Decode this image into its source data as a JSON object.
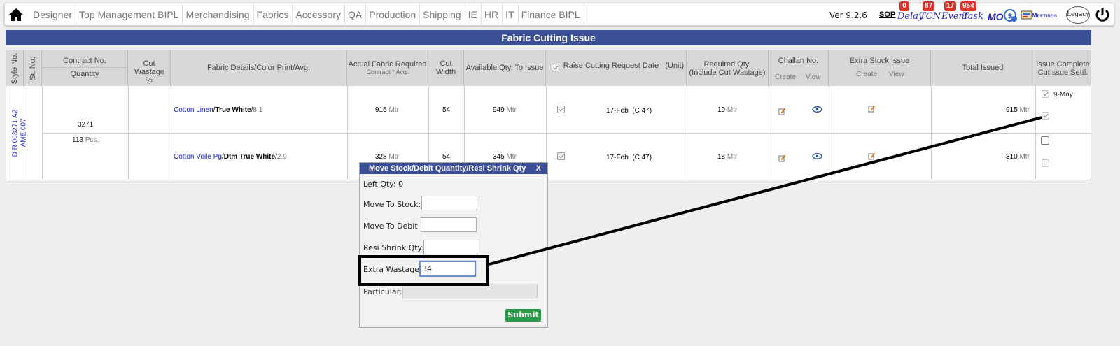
{
  "nav": {
    "menu": [
      "Designer",
      "Top Management BIPL",
      "Merchandising",
      "Fabrics",
      "Accessory",
      "QA",
      "Production",
      "Shipping",
      "IE",
      "HR",
      "IT",
      "Finance BIPL"
    ],
    "version": "Ver 9.2.6",
    "sop": "SOP",
    "delay": {
      "label": "Delay",
      "count": "0"
    },
    "tcn": {
      "label": "TCN",
      "count": "87"
    },
    "event": {
      "label": "Event",
      "count": "17"
    },
    "task": {
      "label": "Task",
      "count": "954"
    },
    "mo": "MO",
    "meetings": "Meetings",
    "legacy": "Legacy"
  },
  "page": {
    "title": "Fabric Cutting Issue"
  },
  "table": {
    "headers": {
      "style_no": "Style No.",
      "sr_no": "Sr. No.",
      "contract_no": "Contract No.",
      "quantity": "Quantity",
      "cut_wastage": "Cut Wastage %",
      "fabric_details": "Fabric Details/Color Print/Avg.",
      "actual_fabric": "Actual Fabric Required",
      "actual_fabric_sub": "Contract * Avg.",
      "cut_width": "Cut Width",
      "available_qty": "Available Qty. To Issue",
      "raise_date": "Raise Cutting Request Date",
      "raise_unit": "(Unit)",
      "required_qty": "Required Qty.",
      "required_qty_sub": "(Include Cut Wastage)",
      "challan": "Challan No.",
      "create": "Create",
      "view": "View",
      "extra_stock": "Extra Stock Issue",
      "total_issued": "Total Issued",
      "issue_complete": "Issue Complete",
      "cut_issue_settl": "CutIssue Settl."
    },
    "style_no": "D R 003271 A2",
    "sr_no": "AME 007",
    "contract_no": "3271",
    "quantity": "113",
    "quantity_unit": "Pcs.",
    "rows": [
      {
        "fabric": "Cotton Linen",
        "color": "True White",
        "avg": "8.1",
        "actual": "915",
        "cut_width": "54",
        "available": "949",
        "raise_date": "17-Feb",
        "raise_unit": "(C 47)",
        "required": "19",
        "total_issued": "915",
        "issue_date": "9-May"
      },
      {
        "fabric": "Cotton Voile Pg",
        "color": "Dtm True White",
        "avg": "2.9",
        "actual": "328",
        "cut_width": "54",
        "available": "345",
        "raise_date": "17-Feb",
        "raise_unit": "(C 47)",
        "required": "18",
        "total_issued": "310"
      }
    ],
    "unit": "Mtr"
  },
  "popup": {
    "title": "Move Stock/Debit Quantity/Resi Shrink Qty",
    "close": "X",
    "left_qty_label": "Left Qty:",
    "left_qty_value": "0",
    "move_to_stock": {
      "label": "Move To Stock:",
      "value": ""
    },
    "move_to_debit": {
      "label": "Move To Debit:",
      "value": ""
    },
    "resi_shrink": {
      "label": "Resi Shrink Qty:",
      "value": ""
    },
    "extra_wastage": {
      "label": "Extra Wastage:",
      "value": "34"
    },
    "particular": {
      "label": "Particular:",
      "value": ""
    },
    "submit": "Submit"
  },
  "colors": {
    "header_bar": "#3b4f96",
    "submit": "#2b9a48",
    "badge": "#d9342b",
    "link": "#1a20c8"
  }
}
